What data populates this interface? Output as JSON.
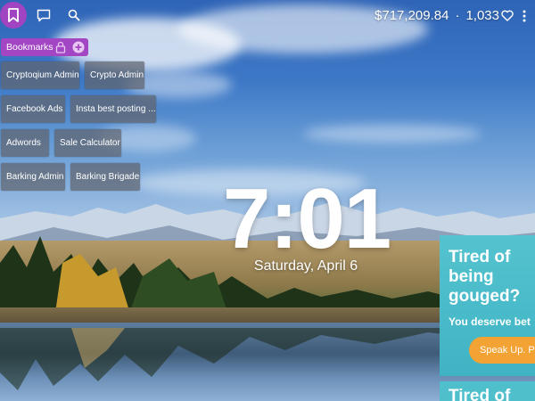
{
  "topbar": {
    "icons": {
      "bookmarks": "bookmark-icon",
      "chat": "chat-icon",
      "search": "search-icon",
      "heart": "heart-icon",
      "menu": "more-vertical-icon"
    },
    "balance": "$717,209.84",
    "separator": "·",
    "likes": "1,033"
  },
  "bookmarks": {
    "header_label": "Bookmarks",
    "items": [
      "Cryptoqium Admin",
      "Crypto Admin",
      "Facebook Ads",
      "Insta best posting ...",
      "Adwords",
      "Sale Calculator",
      "Barking Admin",
      "Barking Brigade"
    ]
  },
  "clock": {
    "time": "7:01",
    "date": "Saturday, April 6"
  },
  "ad": {
    "title": "Tired of being gouged?",
    "subtitle": "You deserve bet",
    "button": "Speak Up. P",
    "next_title": "Tired of"
  },
  "colors": {
    "accent": "#a044c2",
    "ad_bg": "#45b8c8",
    "ad_button": "#f3a234"
  }
}
